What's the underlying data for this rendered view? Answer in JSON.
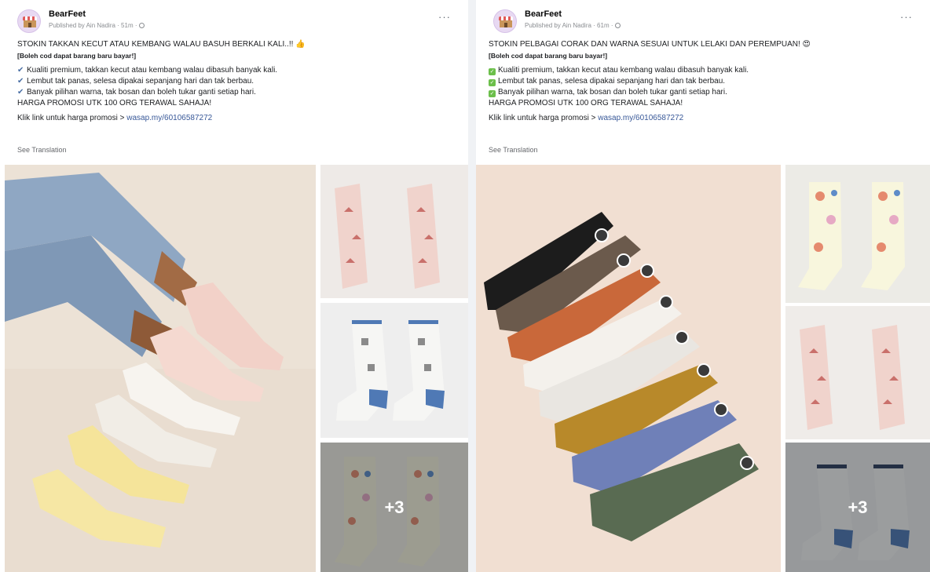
{
  "posts": [
    {
      "page_name": "BearFeet",
      "meta": "Published by Ain Nadira · 51m ·",
      "more_label": "···",
      "headline": "STOKIN TAKKAN KECUT ATAU KEMBANG WALAU BASUH BERKALI KALI..!! 👍",
      "subline": "[Boleh cod dapat barang baru bayar!]",
      "bullets": [
        "Kualiti premium, takkan kecut atau kembang walau dibasuh banyak kali.",
        "Lembut tak panas, selesa dipakai sepanjang hari dan tak berbau.",
        "Banyak pilihan warna, tak bosan dan boleh tukar ganti setiap hari."
      ],
      "promo": "HARGA PROMOSI UTK 100 ORG TERAWAL SAHAJA!",
      "link_prefix": "Klik link untuk harga promosi > ",
      "link_text": "wasap.my/60106587272",
      "see_translation": "See Translation",
      "more_photos": "+3"
    },
    {
      "page_name": "BearFeet",
      "meta": "Published by Ain Nadira · 61m ·",
      "more_label": "···",
      "headline": "STOKIN PELBAGAI CORAK DAN WARNA SESUAI UNTUK LELAKI DAN PEREMPUAN! 😍",
      "subline": "[Boleh cod dapat barang baru bayar!]",
      "bullets": [
        "Kualiti premium, takkan kecut atau kembang walau dibasuh banyak kali.",
        "Lembut tak panas, selesa dipakai sepanjang hari dan tak berbau.",
        "Banyak pilihan warna, tak bosan dan boleh tukar ganti setiap hari."
      ],
      "promo": "HARGA PROMOSI UTK 100 ORG TERAWAL SAHAJA!",
      "link_prefix": "Klik link untuk harga promosi > ",
      "link_text": "wasap.my/60106587272",
      "see_translation": "See Translation",
      "more_photos": "+3"
    }
  ],
  "icons": {
    "bullet_left": "check-mark-icon",
    "bullet_right": "green-checkbox-icon"
  },
  "colors": {
    "link": "#385898",
    "muted": "#65676b",
    "check_green": "#6cbf4b"
  }
}
